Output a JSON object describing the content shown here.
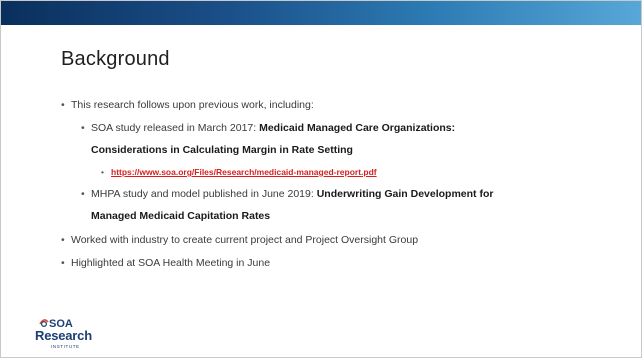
{
  "slide": {
    "title": "Background",
    "bullets": {
      "b1": "This research follows upon previous work, including:",
      "b1_1_prefix": "SOA study released in March 2017: ",
      "b1_1_bold_a": "Medicaid Managed Care Organizations:",
      "b1_1_bold_b": "Considerations in Calculating Margin in Rate Setting",
      "b1_1_1_link": "https://www.soa.org/Files/Research/medicaid-managed-report.pdf",
      "b1_2_prefix": "MHPA study and model published in June 2019: ",
      "b1_2_bold_a": "Underwriting Gain Development for",
      "b1_2_bold_b": "Managed Medicaid Capitation Rates",
      "b2": "Worked with industry to create current project and Project Oversight Group",
      "b3": "Highlighted at SOA Health Meeting in June"
    },
    "logo": {
      "top": "SOA",
      "main": "Research",
      "sub": "INSTITUTE"
    }
  },
  "colors": {
    "header_gradient_start": "#0a2f5c",
    "header_gradient_end": "#57a7d8",
    "link": "#d62020",
    "logo": "#1c3f73"
  }
}
